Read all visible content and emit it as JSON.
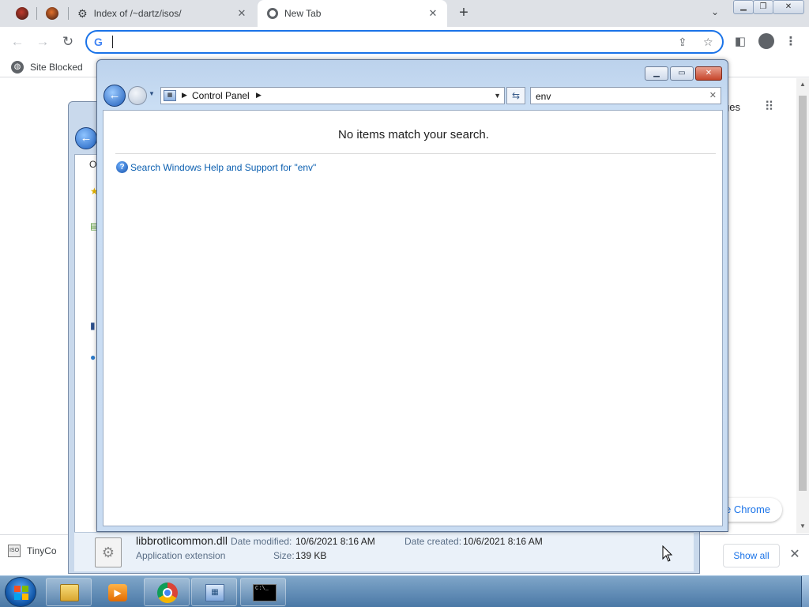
{
  "tabs": [
    {
      "title": "",
      "active": false
    },
    {
      "title": "",
      "active": false
    },
    {
      "title": "Index of /~dartz/isos/",
      "active": false
    },
    {
      "title": "New Tab",
      "active": true
    }
  ],
  "toolbar": {
    "omnibox_value": "",
    "bookmark_label": "Site Blocked"
  },
  "newtab_page": {
    "partial_images_text": "ges",
    "customize_partial": "e Chrome"
  },
  "download_bar": {
    "item_label": "TinyCo",
    "show_all": "Show all"
  },
  "background_window": {
    "partial_label": "O",
    "file": {
      "name": "libbrotlicommon.dll",
      "type": "Application extension",
      "date_modified_label": "Date modified:",
      "date_modified": "10/6/2021 8:16 AM",
      "date_created_label": "Date created:",
      "date_created": "10/6/2021 8:16 AM",
      "size_label": "Size:",
      "size": "139 KB"
    }
  },
  "control_panel": {
    "breadcrumb": "Control Panel",
    "search_value": "env",
    "no_match_text": "No items match your search.",
    "help_link": "Search Windows Help and Support for \"env\""
  },
  "colors": {
    "chrome_accent": "#1a73e8",
    "link_blue": "#0b5fb0",
    "taskbar": "#4a78a6"
  }
}
